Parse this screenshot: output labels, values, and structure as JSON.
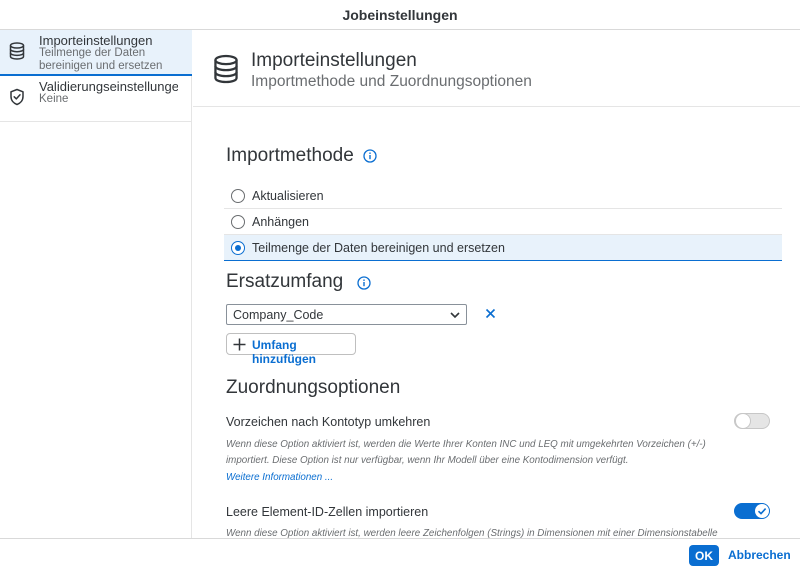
{
  "dialog": {
    "title": "Jobeinstellungen"
  },
  "sidebar": {
    "items": [
      {
        "title": "Importeinstellungen",
        "subtitle": "Teilmenge der Daten bereinigen und ersetzen",
        "icon": "database-icon",
        "active": true
      },
      {
        "title": "Validierungseinstellungen",
        "subtitle": "Keine",
        "icon": "shield-check-icon",
        "active": false
      }
    ]
  },
  "content_header": {
    "title": "Importeinstellungen",
    "subtitle": "Importmethode und Zuordnungsoptionen",
    "icon": "database-icon"
  },
  "import_method": {
    "title": "Importmethode",
    "options": [
      {
        "label": "Aktualisieren",
        "selected": false
      },
      {
        "label": "Anhängen",
        "selected": false
      },
      {
        "label": "Teilmenge der Daten bereinigen und ersetzen",
        "selected": true
      }
    ]
  },
  "replacement_scope": {
    "title": "Ersatzumfang",
    "select_value": "Company_Code",
    "add_label": "Umfang hinzufügen"
  },
  "mapping_options": {
    "title": "Zuordnungsoptionen",
    "options": [
      {
        "label": "Vorzeichen nach Kontotyp umkehren",
        "description": "Wenn diese Option aktiviert ist, werden die Werte Ihrer Konten INC und LEQ mit umgekehrten Vorzeichen (+/-) importiert. Diese Option ist nur verfügbar, wenn Ihr Modell über eine Kontodimension verfügt.",
        "link": "Weitere Informationen ...",
        "enabled": false
      },
      {
        "label": "Leere Element-ID-Zellen importieren",
        "description": "Wenn diese Option aktiviert ist, werden leere Zeichenfolgen (Strings) in Dimensionen mit einer Dimensionstabelle",
        "enabled": true
      }
    ]
  },
  "footer": {
    "ok_label": "OK",
    "cancel_label": "Abbrechen"
  },
  "colors": {
    "accent": "#0a6ed1",
    "selected_bg": "#e8f2fb",
    "text": "#32363a",
    "muted": "#6a6d70"
  }
}
